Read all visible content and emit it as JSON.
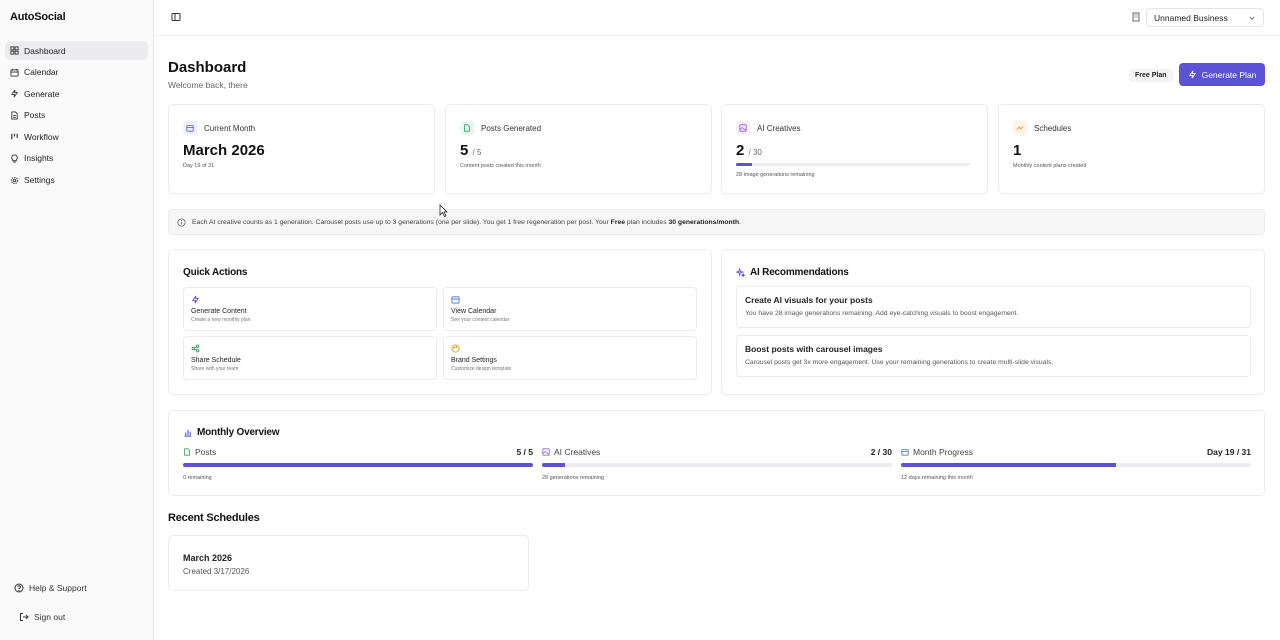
{
  "brand": "AutoSocial",
  "sidebar": {
    "items": [
      {
        "label": "Dashboard",
        "icon": "dashboard-icon",
        "active": true
      },
      {
        "label": "Calendar",
        "icon": "calendar-icon"
      },
      {
        "label": "Generate",
        "icon": "lightning-icon"
      },
      {
        "label": "Posts",
        "icon": "file-icon"
      },
      {
        "label": "Workflow",
        "icon": "kanban-icon"
      },
      {
        "label": "Insights",
        "icon": "lightbulb-icon"
      },
      {
        "label": "Settings",
        "icon": "gear-icon"
      }
    ],
    "help": "Help & Support",
    "signout": "Sign out"
  },
  "topbar": {
    "business": "Unnamed Business"
  },
  "header": {
    "title": "Dashboard",
    "subtitle": "Welcome back, there",
    "plan_badge": "Free Plan",
    "generate_button": "Generate Plan"
  },
  "stats": {
    "current_month": {
      "label": "Current Month",
      "value": "March 2026",
      "note": "Day 19 of 31"
    },
    "posts": {
      "label": "Posts Generated",
      "value": "5",
      "of": "/ 5",
      "note": "Content posts created this month"
    },
    "creatives": {
      "label": "AI Creatives",
      "value": "2",
      "of": "/ 30",
      "note": "28 image generations remaining",
      "progress": 0.067
    },
    "schedules": {
      "label": "Schedules",
      "value": "1",
      "note": "Monthly content plans created"
    }
  },
  "info": {
    "text_1": "Each AI creative counts as 1 generation. Carousel posts use up to 3 generations (one per slide). You get 1 free regeneration per post. Your ",
    "plan": "Free",
    "text_2": " plan includes ",
    "quota": "30 generations/month",
    "text_3": "."
  },
  "quick_actions": {
    "title": "Quick Actions",
    "items": [
      {
        "title": "Generate Content",
        "sub": "Create a new monthly plan"
      },
      {
        "title": "View Calendar",
        "sub": "See your content calendar"
      },
      {
        "title": "Share Schedule",
        "sub": "Share with your team"
      },
      {
        "title": "Brand Settings",
        "sub": "Customize design template"
      }
    ]
  },
  "recommendations": {
    "title": "AI Recommendations",
    "items": [
      {
        "title": "Create AI visuals for your posts",
        "desc": "You have 28 image generations remaining. Add eye-catching visuals to boost engagement."
      },
      {
        "title": "Boost posts with carousel images",
        "desc": "Carousel posts get 3x more engagement. Use your remaining generations to create multi-slide visuals."
      }
    ]
  },
  "overview": {
    "title": "Monthly Overview",
    "columns": [
      {
        "label": "Posts",
        "value": "5 / 5",
        "note": "0 remaining",
        "progress": 1.0
      },
      {
        "label": "AI Creatives",
        "value": "2 / 30",
        "note": "28 generations remaining",
        "progress": 0.067
      },
      {
        "label": "Month Progress",
        "value": "Day 19 / 31",
        "note": "12 days remaining this month",
        "progress": 0.613
      }
    ]
  },
  "recent": {
    "title": "Recent Schedules",
    "items": [
      {
        "title": "March 2026",
        "sub": "Created 3/17/2026"
      }
    ]
  },
  "colors": {
    "accent": "#5b52d6"
  }
}
